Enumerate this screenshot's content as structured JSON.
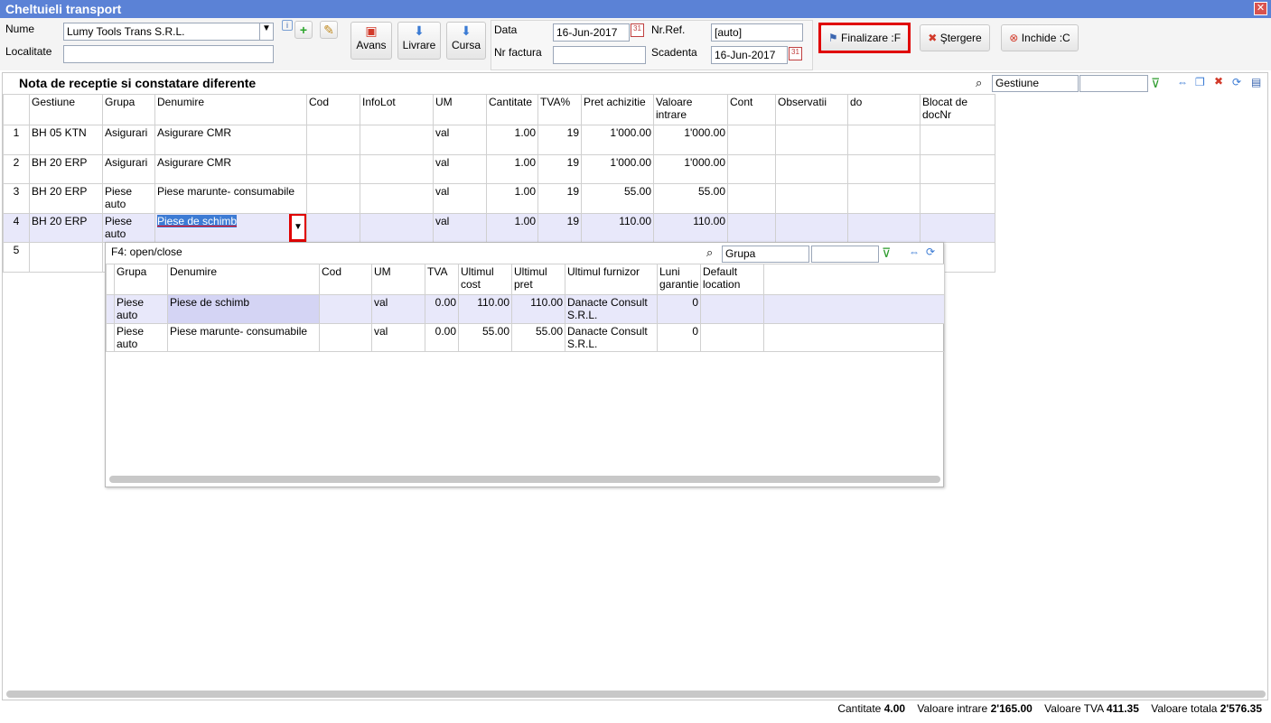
{
  "window": {
    "title": "Cheltuieli transport"
  },
  "header": {
    "nume_label": "Nume",
    "nume_value": "Lumy Tools Trans S.R.L.",
    "localitate_label": "Localitate",
    "localitate_value": "",
    "avans_label": "Avans",
    "livrare_label": "Livrare",
    "cursa_label": "Cursa",
    "data_label": "Data",
    "data_value": "16-Jun-2017",
    "nrref_label": "Nr.Ref.",
    "nrref_value": "[auto]",
    "nrfactura_label": "Nr factura",
    "nrfactura_value": "",
    "scadenta_label": "Scadenta",
    "scadenta_value": "16-Jun-2017",
    "finalizare_label": "Finalizare :F",
    "stergere_label": "Ştergere",
    "inchide_label": "Inchide :C"
  },
  "section": {
    "title": "Nota de receptie si constatare diferente",
    "filter_select": "Gestiune",
    "filter_value": ""
  },
  "grid": {
    "columns": [
      "",
      "Gestiune",
      "Grupa",
      "Denumire",
      "Cod",
      "InfoLot",
      "UM",
      "Cantitate",
      "TVA%",
      "Pret achizitie",
      "Valoare intrare",
      "Cont",
      "Observatii",
      "do",
      "Blocat de docNr"
    ],
    "rows": [
      {
        "n": "1",
        "gestiune": "BH 05 KTN",
        "grupa": "Asigurari",
        "denumire": "Asigurare CMR",
        "um": "val",
        "cantitate": "1.00",
        "tva": "19",
        "pret": "1'000.00",
        "valoare": "1'000.00"
      },
      {
        "n": "2",
        "gestiune": "BH 20 ERP",
        "grupa": "Asigurari",
        "denumire": "Asigurare CMR",
        "um": "val",
        "cantitate": "1.00",
        "tva": "19",
        "pret": "1'000.00",
        "valoare": "1'000.00"
      },
      {
        "n": "3",
        "gestiune": "BH 20 ERP",
        "grupa": "Piese auto",
        "denumire": "Piese marunte- consumabile",
        "um": "val",
        "cantitate": "1.00",
        "tva": "19",
        "pret": "55.00",
        "valoare": "55.00"
      },
      {
        "n": "4",
        "gestiune": "BH 20 ERP",
        "grupa": "Piese auto",
        "denumire": "Piese de schimb",
        "um": "val",
        "cantitate": "1.00",
        "tva": "19",
        "pret": "110.00",
        "valoare": "110.00"
      },
      {
        "n": "5"
      }
    ]
  },
  "popup": {
    "title": "F4: open/close",
    "filter_select": "Grupa",
    "filter_value": "",
    "columns": [
      "",
      "Grupa",
      "Denumire",
      "Cod",
      "UM",
      "TVA",
      "Ultimul cost",
      "Ultimul pret",
      "Ultimul furnizor",
      "Luni garantie",
      "Default location"
    ],
    "rows": [
      {
        "grupa": "Piese auto",
        "denumire": "Piese de schimb",
        "cod": "",
        "um": "val",
        "tva": "0.00",
        "cost": "110.00",
        "pret": "110.00",
        "furnizor": "Danacte Consult S.R.L.",
        "luni": "0",
        "loc": ""
      },
      {
        "grupa": "Piese auto",
        "denumire": "Piese marunte- consumabile",
        "cod": "",
        "um": "val",
        "tva": "0.00",
        "cost": "55.00",
        "pret": "55.00",
        "furnizor": "Danacte Consult S.R.L.",
        "luni": "0",
        "loc": ""
      }
    ]
  },
  "footer": {
    "cantitate_label": "Cantitate",
    "cantitate_value": "4.00",
    "vi_label": "Valoare intrare",
    "vi_value": "2'165.00",
    "vtva_label": "Valoare TVA",
    "vtva_value": "411.35",
    "vt_label": "Valoare totala",
    "vt_value": "2'576.35"
  },
  "colors": {
    "titlebar": "#5b82d6",
    "highlight": "#e00000",
    "selection": "#3d7bd4"
  }
}
